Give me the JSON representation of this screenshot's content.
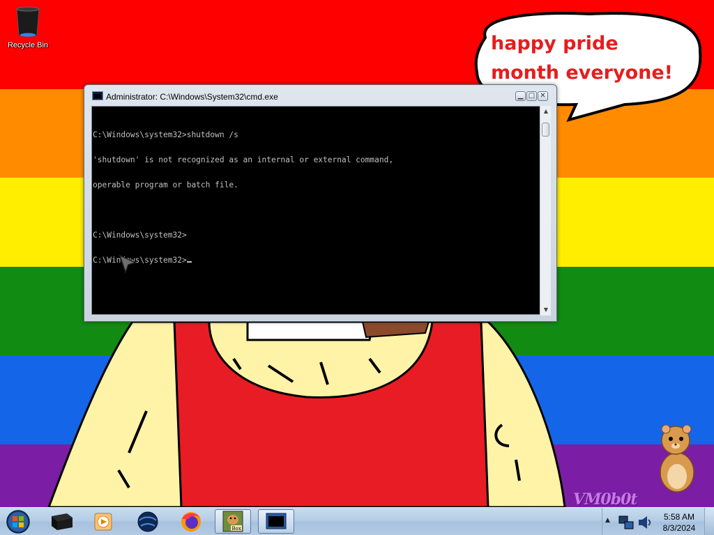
{
  "desktop": {
    "recycle_bin_label": "Recycle Bin",
    "speech_bubble_text": "happy pride month everyone!",
    "watermark_text": "VM0b0t",
    "wallpaper_colors": [
      "#ff0000",
      "#ff8c00",
      "#ffee00",
      "#118b11",
      "#1565e8",
      "#7b1ea5"
    ]
  },
  "cmd_window": {
    "title": "Administrator: C:\\Windows\\System32\\cmd.exe",
    "lines": [
      "C:\\Windows\\system32>shutdown /s",
      "'shutdown' is not recognized as an internal or external command,",
      "operable program or batch file.",
      "",
      "C:\\Windows\\system32>",
      "C:\\Windows\\system32>"
    ],
    "minimize_symbol": "▁",
    "maximize_symbol": "□",
    "close_symbol": "✕"
  },
  "taskbar": {
    "start_icon": "windows-orb-icon",
    "pinned": [
      {
        "name": "black-box-app-icon"
      },
      {
        "name": "media-player-icon"
      },
      {
        "name": "globe-browser-icon"
      },
      {
        "name": "firefox-icon"
      },
      {
        "name": "hamster-box-app-icon",
        "label": "Box"
      },
      {
        "name": "cmd-window-icon"
      }
    ],
    "tray_chevron": "▲",
    "clock_time": "5:58 AM",
    "clock_date": "8/3/2024"
  }
}
